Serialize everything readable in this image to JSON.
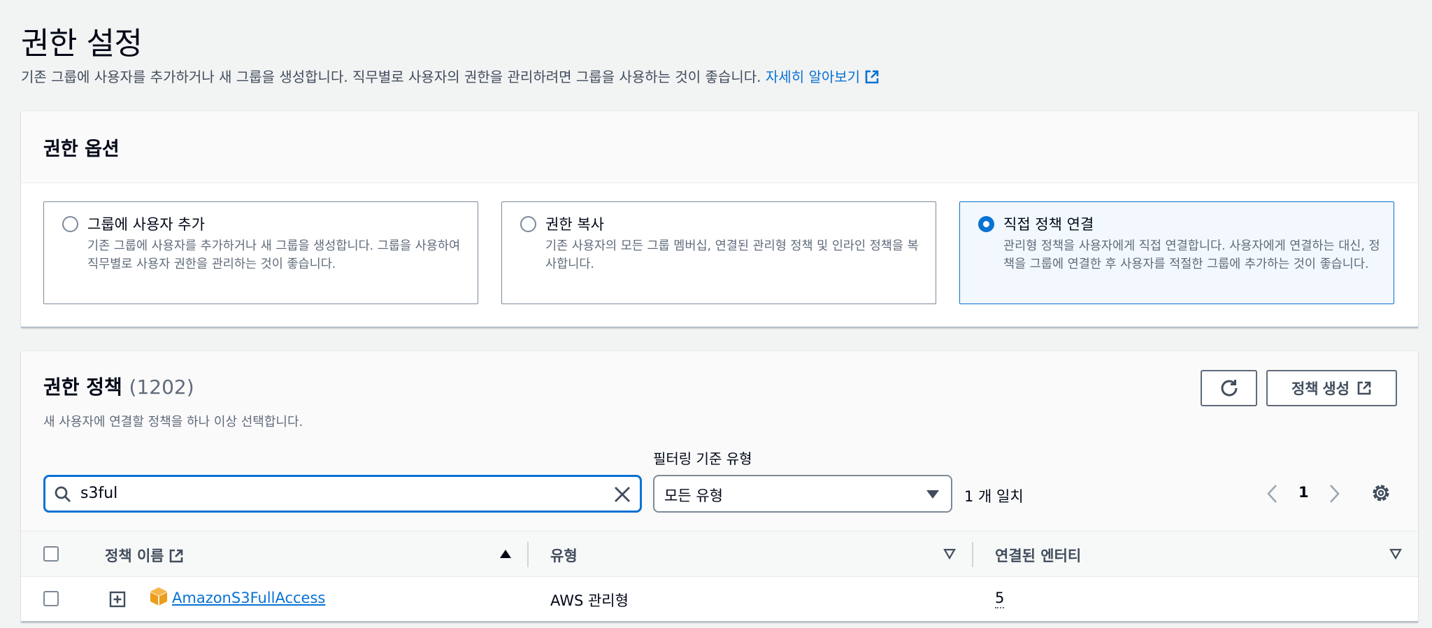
{
  "header": {
    "title": "권한 설정",
    "description": "기존 그룹에 사용자를 추가하거나 새 그룹을 생성합니다. 직무별로 사용자의 권한을 관리하려면 그룹을 사용하는 것이 좋습니다.",
    "learn_more": "자세히 알아보기"
  },
  "options_panel": {
    "title": "권한 옵션",
    "tiles": [
      {
        "title": "그룹에 사용자 추가",
        "description": "기존 그룹에 사용자를 추가하거나 새 그룹을 생성합니다. 그룹을 사용하여 직무별로 사용자 권한을 관리하는 것이 좋습니다.",
        "selected": false
      },
      {
        "title": "권한 복사",
        "description": "기존 사용자의 모든 그룹 멤버십, 연결된 관리형 정책 및 인라인 정책을 복사합니다.",
        "selected": false
      },
      {
        "title": "직접 정책 연결",
        "description": "관리형 정책을 사용자에게 직접 연결합니다. 사용자에게 연결하는 대신, 정책을 그룹에 연결한 후 사용자를 적절한 그룹에 추가하는 것이 좋습니다.",
        "selected": true
      }
    ]
  },
  "policies_panel": {
    "title": "권한 정책",
    "count": "(1202)",
    "description": "새 사용자에 연결할 정책을 하나 이상 선택합니다.",
    "create_button": "정책 생성",
    "filter_label": "필터링 기준 유형",
    "search": {
      "value": "s3ful",
      "placeholder": ""
    },
    "filter_select": "모든 유형",
    "match_count": "1 개 일치",
    "page": "1",
    "columns": [
      "정책 이름",
      "유형",
      "연결된 엔터티"
    ],
    "rows": [
      {
        "name": "AmazonS3FullAccess",
        "type": "AWS 관리형",
        "attached": "5"
      }
    ]
  },
  "colors": {
    "accent": "#0972d3",
    "text": "#000716",
    "muted": "#5f6b7a",
    "background": "#f2f3f3",
    "policy_icon": "#ec9d1e"
  },
  "icons": [
    "external-link-icon",
    "refresh-icon",
    "search-icon",
    "clear-icon",
    "caret-down-icon",
    "chevron-left-icon",
    "chevron-right-icon",
    "gear-icon",
    "sort-asc-icon",
    "sort-desc-icon",
    "expand-icon",
    "policy-box-icon"
  ]
}
